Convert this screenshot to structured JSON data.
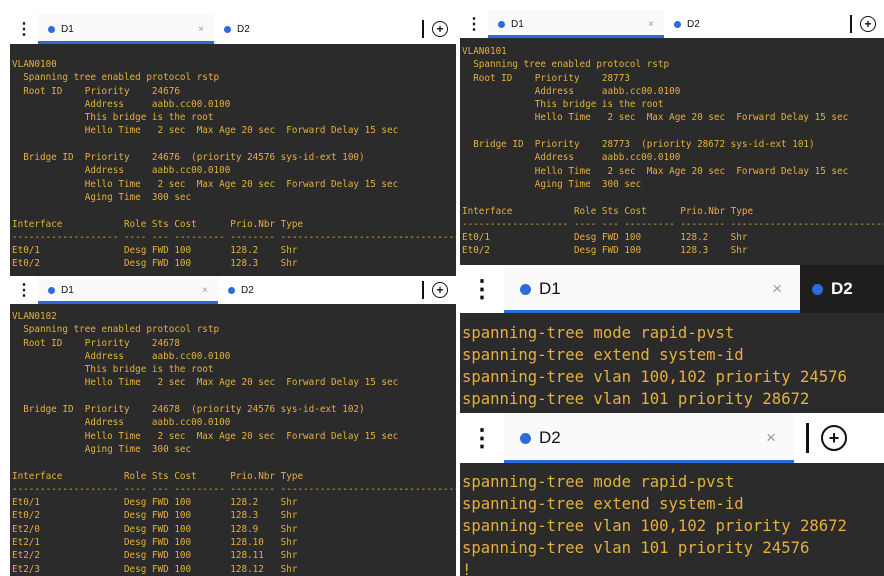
{
  "panels": {
    "top_left": {
      "tabs": [
        {
          "label": "D1",
          "close": "×"
        },
        {
          "label": "D2"
        }
      ],
      "output": "VLAN0100\n  Spanning tree enabled protocol rstp\n  Root ID    Priority    24676\n             Address     aabb.cc00.0100\n             This bridge is the root\n             Hello Time   2 sec  Max Age 20 sec  Forward Delay 15 sec\n\n  Bridge ID  Priority    24676  (priority 24576 sys-id-ext 100)\n             Address     aabb.cc00.0100\n             Hello Time   2 sec  Max Age 20 sec  Forward Delay 15 sec\n             Aging Time  300 sec\n\nInterface           Role Sts Cost      Prio.Nbr Type\n------------------- ---- --- --------- -------- --------------------------------\nEt0/1               Desg FWD 100       128.2    Shr\nEt0/2               Desg FWD 100       128.3    Shr"
    },
    "top_right": {
      "tabs": [
        {
          "label": "D1",
          "close": "×"
        },
        {
          "label": "D2"
        }
      ],
      "output": "VLAN0101\n  Spanning tree enabled protocol rstp\n  Root ID    Priority    28773\n             Address     aabb.cc00.0100\n             This bridge is the root\n             Hello Time   2 sec  Max Age 20 sec  Forward Delay 15 sec\n\n  Bridge ID  Priority    28773  (priority 28672 sys-id-ext 101)\n             Address     aabb.cc00.0100\n             Hello Time   2 sec  Max Age 20 sec  Forward Delay 15 sec\n             Aging Time  300 sec\n\nInterface           Role Sts Cost      Prio.Nbr Type\n------------------- ---- --- --------- -------- --------------------------------\nEt0/1               Desg FWD 100       128.2    Shr\nEt0/2               Desg FWD 100       128.3    Shr"
    },
    "bottom_left": {
      "tabs": [
        {
          "label": "D1",
          "close": "×"
        },
        {
          "label": "D2"
        }
      ],
      "output": "VLAN0102\n  Spanning tree enabled protocol rstp\n  Root ID    Priority    24678\n             Address     aabb.cc00.0100\n             This bridge is the root\n             Hello Time   2 sec  Max Age 20 sec  Forward Delay 15 sec\n\n  Bridge ID  Priority    24678  (priority 24576 sys-id-ext 102)\n             Address     aabb.cc00.0100\n             Hello Time   2 sec  Max Age 20 sec  Forward Delay 15 sec\n             Aging Time  300 sec\n\nInterface           Role Sts Cost      Prio.Nbr Type\n------------------- ---- --- --------- -------- --------------------------------\nEt0/1               Desg FWD 100       128.2    Shr\nEt0/2               Desg FWD 100       128.3    Shr\nEt2/0               Desg FWD 100       128.9    Shr\nEt2/1               Desg FWD 100       128.10   Shr\nEt2/2               Desg FWD 100       128.11   Shr\nEt2/3               Desg FWD 100       128.12   Shr"
    },
    "mid_right": {
      "tabs": [
        {
          "label": "D1",
          "close": "×"
        },
        {
          "label": "D2"
        }
      ],
      "output": "spanning-tree mode rapid-pvst\nspanning-tree extend system-id\nspanning-tree vlan 100,102 priority 24576\nspanning-tree vlan 101 priority 28672\n!"
    },
    "bottom_right": {
      "tabs": [
        {
          "label": "D2",
          "close": "×"
        }
      ],
      "output": "spanning-tree mode rapid-pvst\nspanning-tree extend system-id\nspanning-tree vlan 100,102 priority 28672\nspanning-tree vlan 101 priority 24576\n!"
    }
  },
  "icons": {
    "menu": "⋮",
    "add": "+"
  },
  "colors": {
    "terminal_bg": "#2b2b2b",
    "terminal_text": "#e5b03c",
    "accent": "#2b6cd9"
  }
}
